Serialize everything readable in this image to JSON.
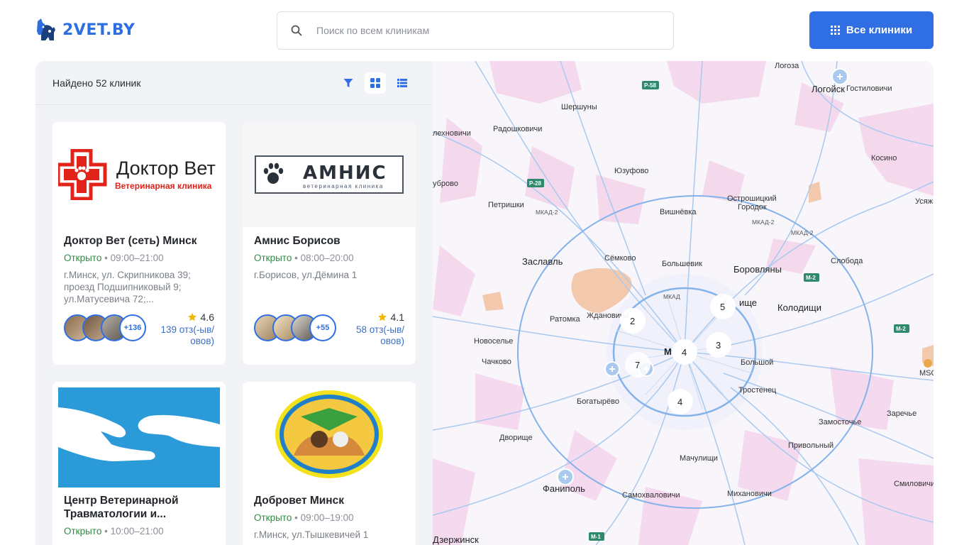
{
  "header": {
    "logo_text": "2VET.BY",
    "search": {
      "placeholder": "Поиск по всем клиникам",
      "value": ""
    },
    "all_clinics_label": "Все клиники"
  },
  "panel": {
    "found_text": "Найдено 52 клиник",
    "view_modes": [
      "filter-icon",
      "grid-view-icon",
      "list-view-icon"
    ]
  },
  "cards": [
    {
      "logo_text": "Доктор Вет",
      "logo_subtext": "Ветеринарная клиника",
      "title": "Доктор Вет (сеть) Минск",
      "status": "Открыто",
      "hours": "09:00–21:00",
      "address": "г.Минск, ул. Скрипникова 39; проезд Подшипниковый 9; ул.Матусевича 72;...",
      "rating": "4.6",
      "reviews": "139 отз(-ыв/ овов)",
      "more_count": "+136"
    },
    {
      "logo_text": "АМНИС",
      "logo_subtext": "ветеринарная клиника",
      "title": "Амнис Борисов",
      "status": "Открыто",
      "hours": "08:00–20:00",
      "address": "г.Борисов, ул.Дёмина 1",
      "rating": "4.1",
      "reviews": "58 отз(-ыв/ овов)",
      "more_count": "+55"
    },
    {
      "title": "Центр Ветеринарной Травматологии и...",
      "status": "Открыто",
      "hours": "10:00–21:00"
    },
    {
      "title": "Добровет Минск",
      "status": "Открыто",
      "hours": "09:00–19:00",
      "address": "г.Минск, ул.Тышкевичей 1"
    }
  ],
  "map": {
    "places": {
      "logoza": "Логоза",
      "logoisk": "Логойск",
      "gostilovichi": "Гостиловичи",
      "shershuny": "Шершуны",
      "radoshkovichi": "Радошковичи",
      "lekhnovichi": "лехновичи",
      "kosino": "Косино",
      "yuzufovo": "Юзуфово",
      "dubrovo": "уброво",
      "petrishki": "Петришки",
      "ostroshitsky": "Острошицкий",
      "gorodok": "Городок",
      "vishnevka": "Вишнёвка",
      "usyazh": "Усяж",
      "semkovo": "Сёмково",
      "zaslavl": "Заславль",
      "bolshevik": "Большевик",
      "borovlyany": "Боровляны",
      "sloboda": "Слобода",
      "kolodishchi": "Колодищи",
      "zhdanovichi": "Ждановичи",
      "ratomka": "Ратомка",
      "novoselye": "Новоселье",
      "chachkovo": "Чачково",
      "bolshoy": "Большой",
      "trostenets": "Тростенец",
      "bogatyrevo": "Богатырёво",
      "dvorishche": "Дворище",
      "zarechye": "Заречье",
      "zamostochye": "Замосточье",
      "privolny": "Привольный",
      "machulishchi": "Мачулищи",
      "fanipol": "Фаниполь",
      "samokhvalovichi": "Самохваловичи",
      "mikhanovichi": "Михановичи",
      "smilovichi": "Смиловичи",
      "dzerzhinsk": "Дзержинск",
      "minsk": "М",
      "ishche": "ище",
      "msq": "MSQ"
    },
    "roads": {
      "r58": "Р-58",
      "r28": "Р-28",
      "m2": "М-2",
      "m1": "М-1",
      "mkad": "МКАД",
      "mkad2": "МКАД-2"
    },
    "clusters": [
      "2",
      "5",
      "4",
      "3",
      "7",
      "4"
    ]
  }
}
